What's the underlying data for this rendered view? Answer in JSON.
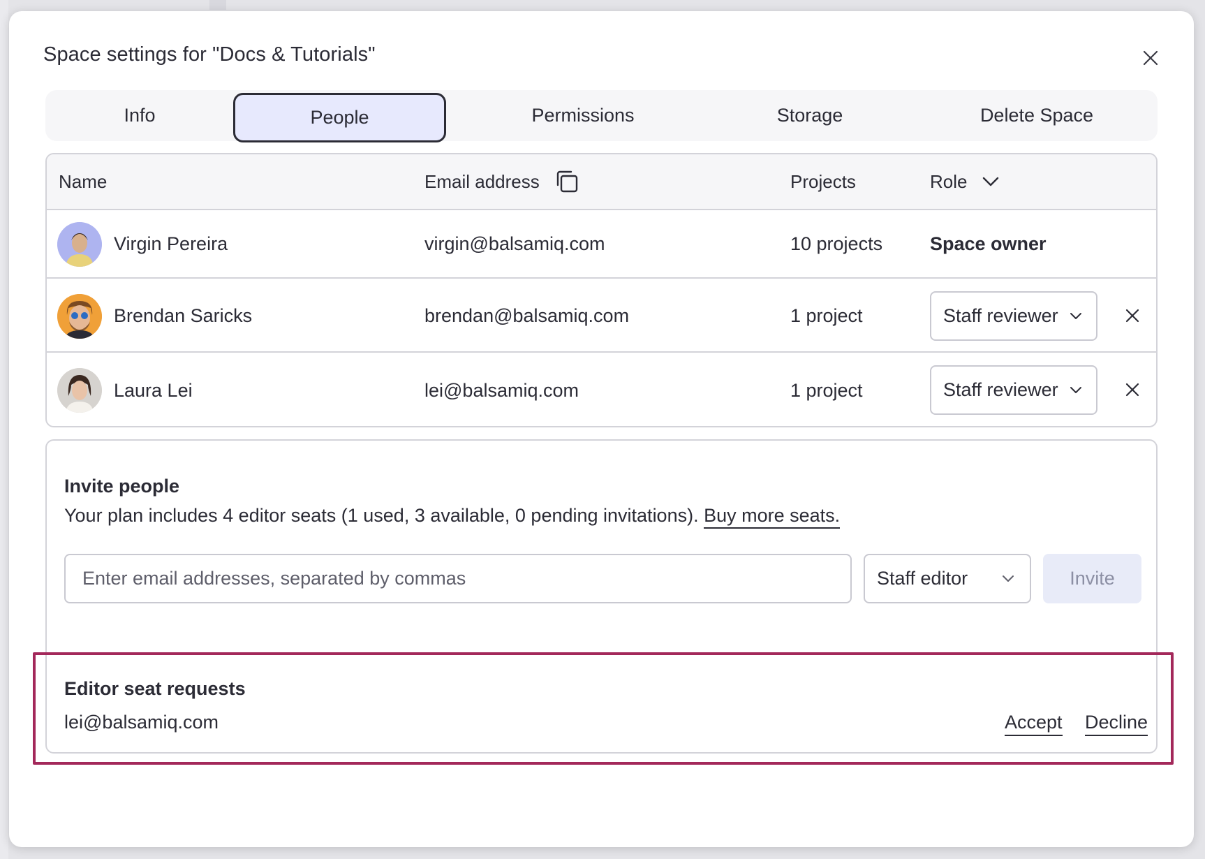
{
  "dialog": {
    "title": "Space settings for \"Docs & Tutorials\"",
    "close_icon": "close-icon"
  },
  "tabs": [
    {
      "label": "Info",
      "active": false
    },
    {
      "label": "People",
      "active": true
    },
    {
      "label": "Permissions",
      "active": false
    },
    {
      "label": "Storage",
      "active": false
    },
    {
      "label": "Delete Space",
      "active": false
    }
  ],
  "table": {
    "headers": {
      "name": "Name",
      "email": "Email address",
      "projects": "Projects",
      "role": "Role"
    },
    "rows": [
      {
        "name": "Virgin Pereira",
        "email": "virgin@balsamiq.com",
        "projects": "10 projects",
        "role": "Space owner",
        "editable": false
      },
      {
        "name": "Brendan Saricks",
        "email": "brendan@balsamiq.com",
        "projects": "1 project",
        "role": "Staff reviewer",
        "editable": true
      },
      {
        "name": "Laura Lei",
        "email": "lei@balsamiq.com",
        "projects": "1 project",
        "role": "Staff reviewer",
        "editable": true
      }
    ]
  },
  "invite": {
    "title": "Invite people",
    "description": "Your plan includes 4 editor seats (1 used, 3 available, 0 pending invitations).",
    "buy_link": "Buy more seats.",
    "email_placeholder": "Enter email addresses, separated by commas",
    "role_value": "Staff editor",
    "invite_label": "Invite"
  },
  "requests": {
    "title": "Editor seat requests",
    "items": [
      {
        "email": "lei@balsamiq.com",
        "accept": "Accept",
        "decline": "Decline"
      }
    ]
  },
  "colors": {
    "active_tab_bg": "#e7e9fd",
    "highlight": "#a3285a",
    "invite_disabled_bg": "#e8ebf8",
    "text": "#2b2b35"
  }
}
